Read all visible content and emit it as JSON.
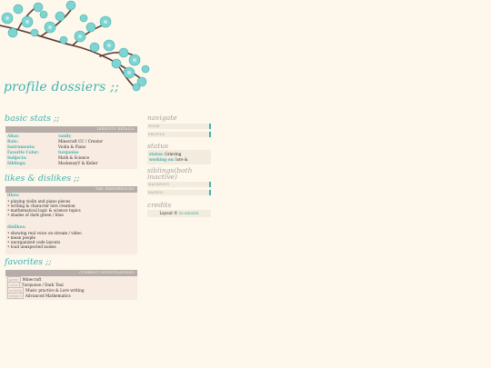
{
  "title": "profile dossiers ;;",
  "colors": {
    "accent": "#3fb3b0",
    "background": "#fdf7ec",
    "bar": "#b6aca8",
    "panel": "#f8ebe2"
  },
  "basic": {
    "heading": "basic stats ;;",
    "bar": "IDENTITY DETAILS",
    "rows": [
      {
        "k": "Alias:",
        "v": "vanity"
      },
      {
        "k": "Role:",
        "v": "Minecraft CC / Creator"
      },
      {
        "k": "Instruments:",
        "v": "Violin & Piano"
      },
      {
        "k": "Favorite Color:",
        "v": "turquoise"
      },
      {
        "k": "Subjects:",
        "v": "Math & Science"
      },
      {
        "k": "Siblings:",
        "v": "MackenzyV & Kelier"
      }
    ]
  },
  "likes": {
    "heading": "likes & dislikes ;;",
    "bar": "THE PREFERENCES",
    "likes_label": "likes:",
    "likes": [
      "• playing violin and piano pieces",
      "• writing & character lore creation",
      "• mathematical logic & science topics",
      "• shades of dark green / blue"
    ],
    "dislikes_label": "dislikes:",
    "dislikes": [
      "• showing real voice on stream / video",
      "• mean people",
      "• unorganized code layouts",
      "• loud unexpected noises"
    ]
  },
  "favorites": {
    "heading": "favorites ;;",
    "bar": "CURRENT INVESTIGATIONS",
    "items": [
      {
        "tag": "game",
        "text": "Minecraft"
      },
      {
        "tag": "color",
        "text": "Turquoise / Dark Teal"
      },
      {
        "tag": "activity",
        "text": "Music practice & Lore writing"
      },
      {
        "tag": "subject",
        "text": "Advanced Mathematics"
      }
    ]
  },
  "navigate": {
    "heading": "navigate",
    "items": [
      "HOME",
      "PROFILE"
    ]
  },
  "status": {
    "heading": "status",
    "status_label": "status:",
    "status_value": "Grieving",
    "working_label": "working on:",
    "working_value": "lore &"
  },
  "siblings": {
    "heading": "siblings(both inactive)",
    "items": [
      "MACKENZY",
      "KAIDEN"
    ]
  },
  "credits": {
    "heading": "credits",
    "prefix": "Layout ©",
    "author": "so-amante"
  }
}
